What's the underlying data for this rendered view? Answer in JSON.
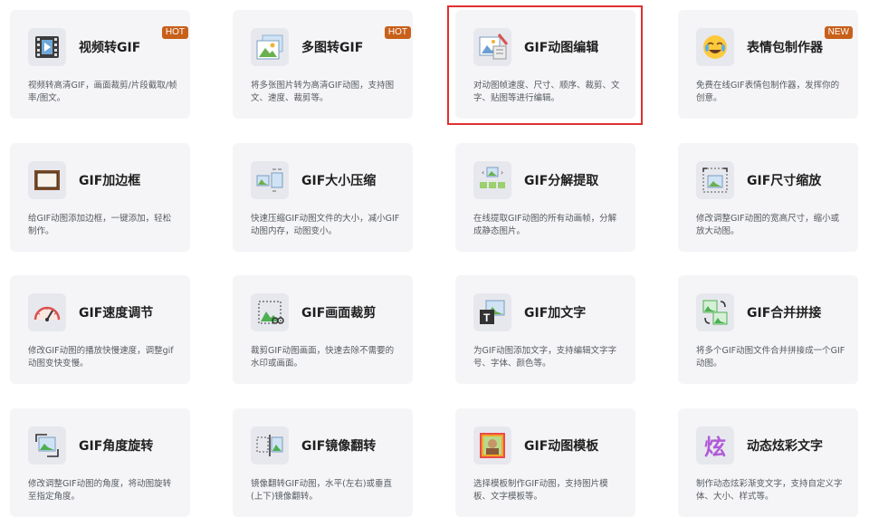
{
  "accent": {
    "badge": "#c8601a",
    "selection": "#e03030"
  },
  "tools": [
    {
      "title": "视频转GIF",
      "desc": "视频转高清GIF，画面裁剪/片段截取/帧率/图文。",
      "badge": "HOT",
      "icon": "video-to-gif-icon"
    },
    {
      "title": "多图转GIF",
      "desc": "将多张图片转为高清GIF动图，支持图文、速度、裁剪等。",
      "badge": "HOT",
      "icon": "images-to-gif-icon"
    },
    {
      "title": "GIF动图编辑",
      "desc": "对动图帧速度、尺寸、顺序、裁剪、文字、贴图等进行编辑。",
      "badge": "",
      "icon": "gif-editor-icon"
    },
    {
      "title": "表情包制作器",
      "desc": "免费在线GIF表情包制作器，发挥你的创意。",
      "badge": "NEW",
      "icon": "emoji-maker-icon"
    },
    {
      "title": "GIF加边框",
      "desc": "给GIF动图添加边框，一键添加，轻松制作。",
      "badge": "",
      "icon": "frame-border-icon"
    },
    {
      "title": "GIF大小压缩",
      "desc": "快速压缩GIF动图文件的大小，减小GIF动图内存，动图变小。",
      "badge": "",
      "icon": "compress-icon"
    },
    {
      "title": "GIF分解提取",
      "desc": "在线提取GIF动图的所有动画帧，分解成静态图片。",
      "badge": "",
      "icon": "split-frames-icon"
    },
    {
      "title": "GIF尺寸缩放",
      "desc": "修改调整GIF动图的宽高尺寸，缩小或放大动图。",
      "badge": "",
      "icon": "resize-icon"
    },
    {
      "title": "GIF速度调节",
      "desc": "修改GIF动图的播放快慢速度，调整gif动图变快变慢。",
      "badge": "",
      "icon": "speedometer-icon"
    },
    {
      "title": "GIF画面裁剪",
      "desc": "裁剪GIF动图画面，快速去除不需要的水印或画面。",
      "badge": "",
      "icon": "crop-icon"
    },
    {
      "title": "GIF加文字",
      "desc": "为GIF动图添加文字，支持编辑文字字号、字体、颜色等。",
      "badge": "",
      "icon": "add-text-icon"
    },
    {
      "title": "GIF合并拼接",
      "desc": "将多个GIF动图文件合并拼接成一个GIF动图。",
      "badge": "",
      "icon": "merge-icon"
    },
    {
      "title": "GIF角度旋转",
      "desc": "修改调整GIF动图的角度，将动图旋转至指定角度。",
      "badge": "",
      "icon": "rotate-icon"
    },
    {
      "title": "GIF镜像翻转",
      "desc": "镜像翻转GIF动图，水平(左右)或垂直(上下)镜像翻转。",
      "badge": "",
      "icon": "mirror-flip-icon"
    },
    {
      "title": "GIF动图模板",
      "desc": "选择模板制作GIF动图，支持图片模板、文字模板等。",
      "badge": "",
      "icon": "template-icon"
    },
    {
      "title": "动态炫彩文字",
      "desc": "制作动态炫彩渐变文字，支持自定义字体、大小、样式等。",
      "badge": "",
      "icon": "colorful-text-icon"
    }
  ]
}
